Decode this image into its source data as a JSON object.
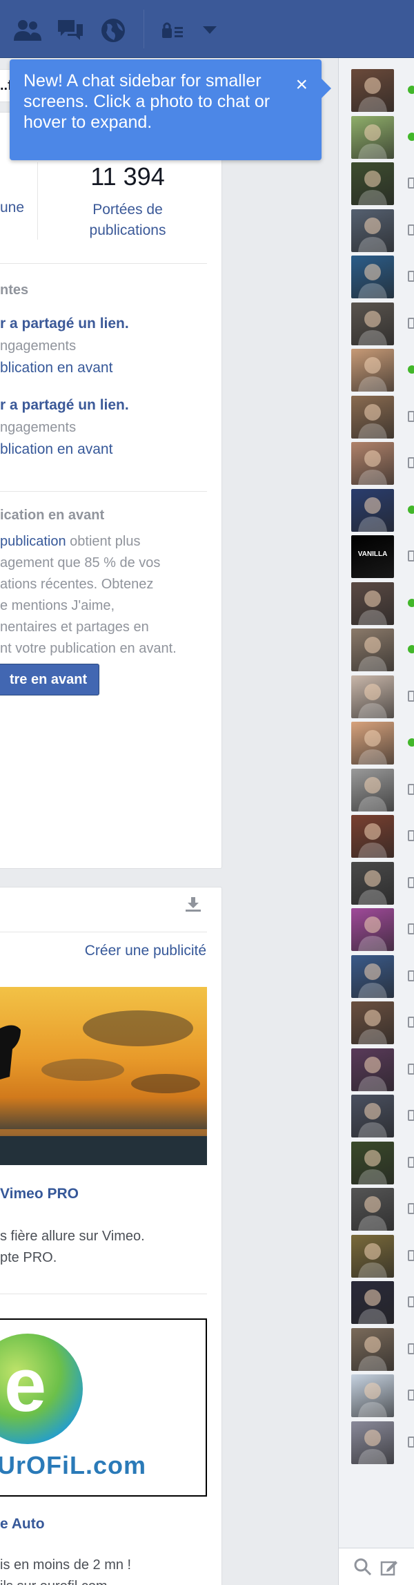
{
  "topbar": {
    "icons": [
      "friend-requests-icon",
      "messages-icon",
      "notifications-globe-icon",
      "privacy-shortcuts-icon",
      "account-menu-chevron-icon"
    ]
  },
  "tooltip": {
    "text": "New! A chat sidebar for smaller screens. Click a photo to chat or hover to expand.",
    "close": "×"
  },
  "page_header": {
    "fragment": "..f"
  },
  "insights": {
    "stat_left_label": "une",
    "stat_right_value": "11 394",
    "stat_right_label_1": "Portées de",
    "stat_right_label_2": "publications",
    "recent_heading": "ntes",
    "posts": [
      {
        "title": "r a partagé un lien.",
        "meta": "ngagements",
        "action": "blication en avant"
      },
      {
        "title": "r a partagé un lien.",
        "meta": "ngagements",
        "action": "blication en avant"
      }
    ],
    "boost_heading": "ication en avant",
    "boost_text_link": "publication",
    "boost_text_line1": " obtient plus",
    "boost_text_line2": "agement que 85 % de vos",
    "boost_text_line3": "ations récentes. Obtenez",
    "boost_text_line4": "e mentions J'aime,",
    "boost_text_line5": "nentaires et partages en",
    "boost_text_line6": "nt votre publication en avant.",
    "boost_button": "tre en avant"
  },
  "ads": {
    "create_ad": "Créer une publicité",
    "ad1_title": "Vimeo PRO",
    "ad1_line1": "s fière allure sur Vimeo.",
    "ad1_line2": "pte PRO.",
    "ad2_logo_letter": "e",
    "ad2_logo_text": "UrOFiL.com",
    "ad2_title": "e Auto",
    "ad2_line1": "is en moins de 2 mn !",
    "ad2_line2": "ils sur eurofil.com"
  },
  "chat": {
    "contacts": [
      {
        "status": "online",
        "color": "#6b4a3a"
      },
      {
        "status": "online",
        "color": "#8fae6a"
      },
      {
        "status": "mobile",
        "color": "#3e4e2f"
      },
      {
        "status": "mobile",
        "color": "#556070"
      },
      {
        "status": "mobile",
        "color": "#2b5d8a"
      },
      {
        "status": "mobile",
        "color": "#5a544e"
      },
      {
        "status": "online",
        "color": "#c79a76"
      },
      {
        "status": "mobile",
        "color": "#8a6b50"
      },
      {
        "status": "mobile",
        "color": "#b0826a"
      },
      {
        "status": "online",
        "color": "#2a3d6e"
      },
      {
        "status": "mobile",
        "color": "#000000",
        "text": "VANILLA"
      },
      {
        "status": "online",
        "color": "#5b4a44"
      },
      {
        "status": "online",
        "color": "#8b7a6a"
      },
      {
        "status": "mobile",
        "color": "#c9b7aa"
      },
      {
        "status": "online",
        "color": "#d7a27c"
      },
      {
        "status": "mobile",
        "color": "#9a9a9a"
      },
      {
        "status": "mobile",
        "color": "#7a4030"
      },
      {
        "status": "mobile",
        "color": "#4a4a4a"
      },
      {
        "status": "mobile",
        "color": "#a04a9a"
      },
      {
        "status": "mobile",
        "color": "#3a5a8a"
      },
      {
        "status": "mobile",
        "color": "#6b5040"
      },
      {
        "status": "mobile",
        "color": "#5a3a5a"
      },
      {
        "status": "mobile",
        "color": "#4a5060"
      },
      {
        "status": "mobile",
        "color": "#3a4a2a"
      },
      {
        "status": "mobile",
        "color": "#555555"
      },
      {
        "status": "mobile",
        "color": "#7a6a3a"
      },
      {
        "status": "mobile",
        "color": "#2a2a3a"
      },
      {
        "status": "mobile",
        "color": "#7a6a5a"
      },
      {
        "status": "mobile",
        "color": "#c6d2e0"
      },
      {
        "status": "mobile",
        "color": "#8a8a9a"
      }
    ]
  }
}
